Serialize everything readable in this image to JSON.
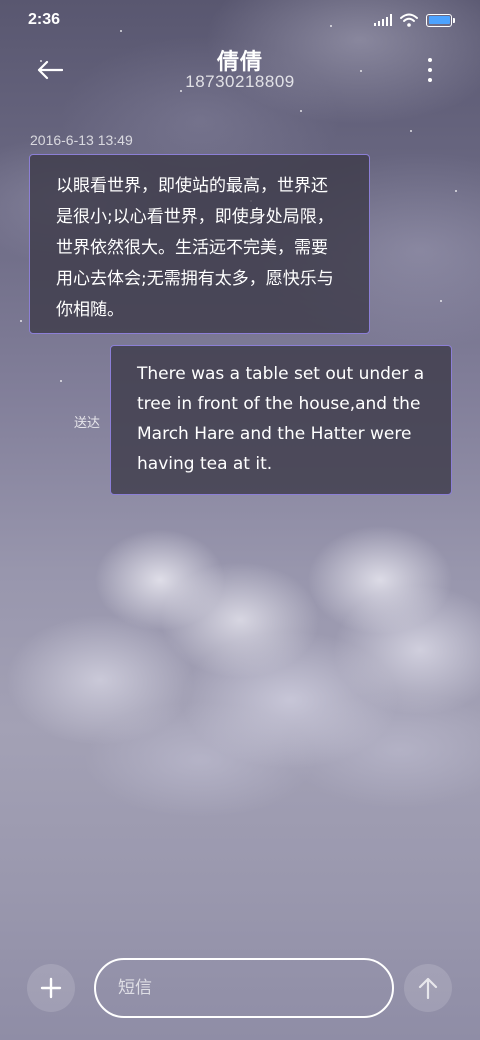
{
  "status_bar": {
    "time": "2:36"
  },
  "header": {
    "contact_name": "倩倩",
    "phone_number": "18730218809"
  },
  "conversation": {
    "timestamp": "2016-6-13 13:49",
    "messages": [
      {
        "direction": "received",
        "text": "以眼看世界，即使站的最高，世界还是很小;以心看世界，即使身处局限，世界依然很大。生活远不完美，需要用心去体会;无需拥有太多，愿快乐与你相随。"
      },
      {
        "direction": "sent",
        "text": "There was a table set out under a tree in front of the house,and the March Hare and the Hatter were having tea at it.",
        "status": "送达"
      }
    ]
  },
  "composer": {
    "placeholder": "短信"
  },
  "icons": {
    "back": "arrow-left-icon",
    "menu": "more-vertical-icon",
    "add": "plus-icon",
    "send": "arrow-up-icon",
    "signal": "signal-icon",
    "wifi": "wifi-icon",
    "battery": "battery-icon"
  },
  "colors": {
    "bubble_border": "#8c7fd6",
    "battery_fill": "#4da3ff"
  }
}
